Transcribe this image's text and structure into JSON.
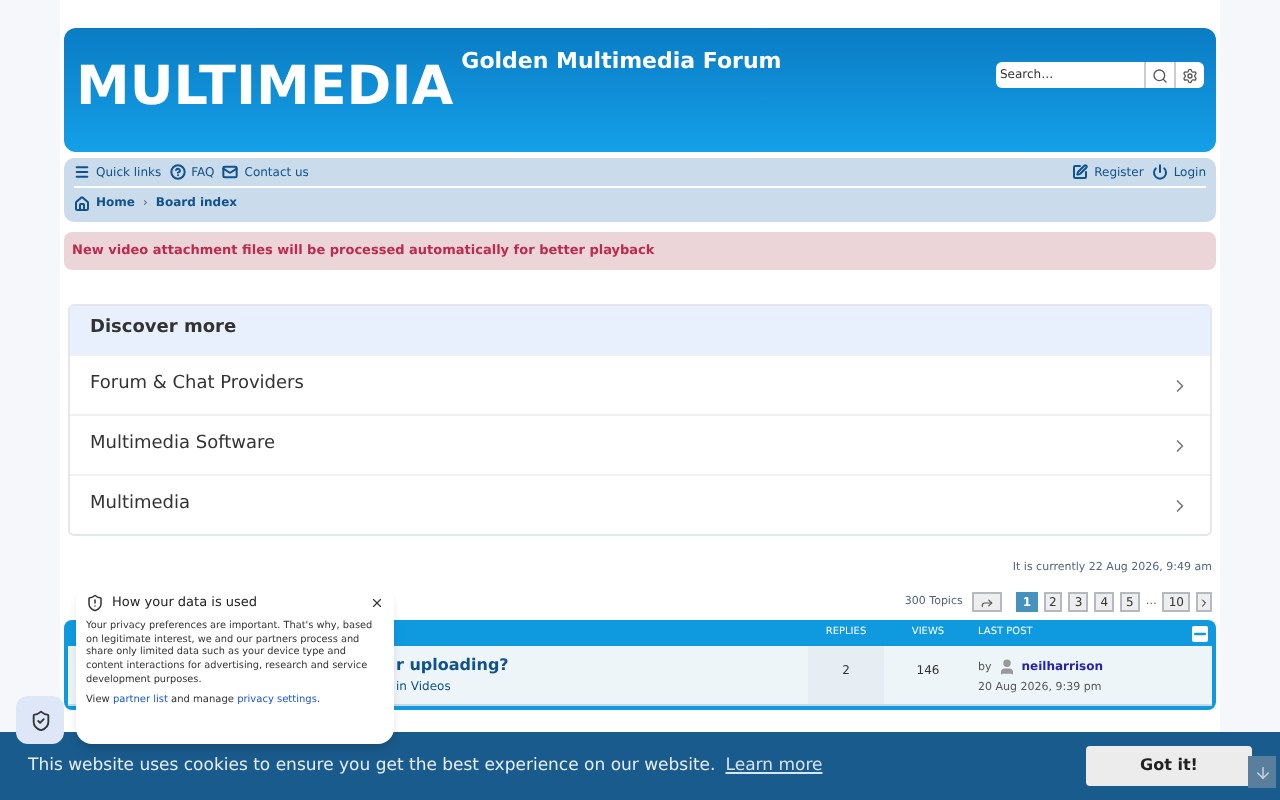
{
  "header": {
    "logo": "MULTIMEDIA",
    "site_title": "Golden Multimedia Forum",
    "search": {
      "placeholder": "Search…"
    }
  },
  "navbar": {
    "left": [
      {
        "kind": "menu",
        "label": "Quick links"
      },
      {
        "kind": "help",
        "label": "FAQ"
      },
      {
        "kind": "mail",
        "label": "Contact us"
      }
    ],
    "right": [
      {
        "kind": "edit",
        "label": "Register"
      },
      {
        "kind": "power",
        "label": "Login"
      }
    ],
    "breadcrumbs": [
      {
        "kind": "home",
        "label": "Home"
      },
      {
        "kind": "plain",
        "label": "Board index"
      }
    ],
    "breadcrumb_separator": "›"
  },
  "alert": "New video attachment files will be processed automatically for better playback",
  "discover": {
    "title": "Discover more",
    "items": [
      "Forum & Chat Providers",
      "Multimedia Software",
      "Multimedia"
    ]
  },
  "current_time": "It is currently 22 Aug 2026, 9:49 am",
  "pagination": {
    "count": "300 Topics",
    "pages": [
      {
        "label": "1",
        "selected": true
      },
      {
        "label": "2",
        "selected": false
      },
      {
        "label": "3",
        "selected": false
      },
      {
        "label": "4",
        "selected": false
      },
      {
        "label": "5",
        "selected": false
      },
      {
        "label": "…",
        "kind": "gap"
      },
      {
        "label": "10",
        "selected": false
      }
    ]
  },
  "table": {
    "columns": [
      "REPLIES",
      "VIEWS",
      "LAST POST"
    ],
    "rows": [
      {
        "title": "r uploading?",
        "forum": "in Videos",
        "replies": "2",
        "views": "146",
        "by": "by",
        "author": "neilharrison",
        "date": "20 Aug 2026, 9:39 pm"
      }
    ]
  },
  "privacy_popup": {
    "title": "How your data is used",
    "body": "Your privacy preferences are important. That's why, based on legitimate interest, we and our partners process and share only limited data such as your device type and content interactions for advertising, research and service development purposes.",
    "footer": [
      "View ",
      "partner list",
      " and manage ",
      "privacy settings",
      "."
    ]
  },
  "cookie_bar": {
    "text": "This website uses cookies to ensure you get the best experience on our website.",
    "link": "Learn more",
    "button": "Got it!"
  }
}
